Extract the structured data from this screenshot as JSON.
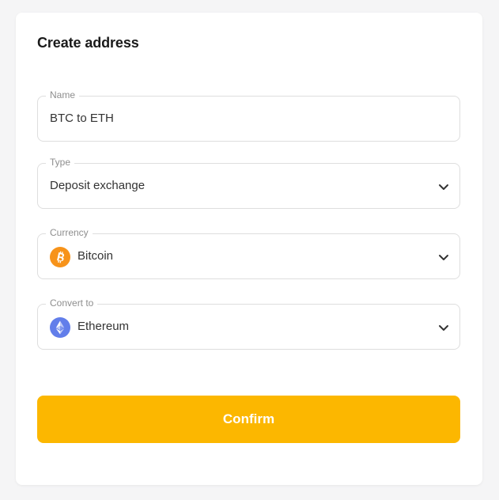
{
  "dialog": {
    "title": "Create address"
  },
  "fields": {
    "name": {
      "label": "Name",
      "value": "BTC to ETH"
    },
    "type": {
      "label": "Type",
      "value": "Deposit exchange"
    },
    "currency": {
      "label": "Currency",
      "value": "Bitcoin",
      "icon": "bitcoin-icon",
      "icon_color": "#f7931a"
    },
    "convert_to": {
      "label": "Convert to",
      "value": "Ethereum",
      "icon": "ethereum-icon",
      "icon_color": "#627eea"
    }
  },
  "actions": {
    "confirm_label": "Confirm",
    "confirm_color": "#fcb700"
  }
}
